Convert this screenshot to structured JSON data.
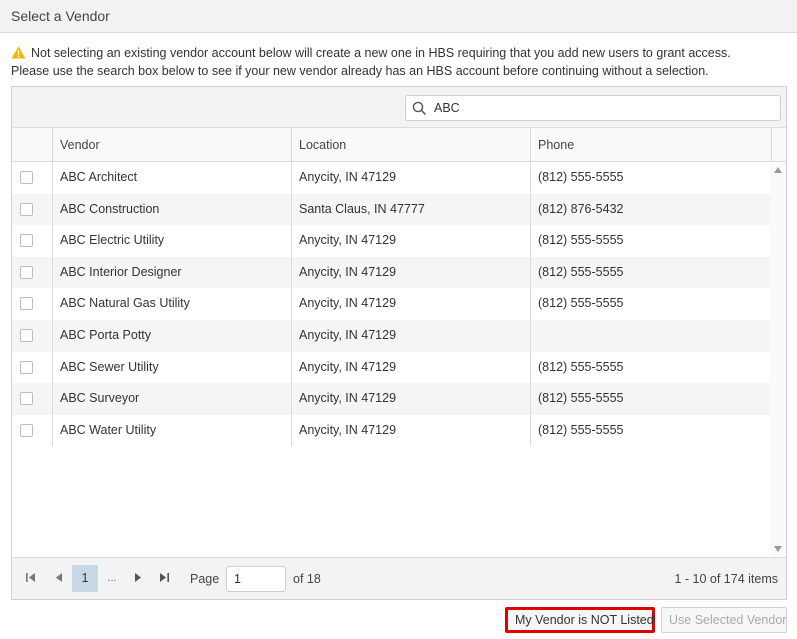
{
  "dialog": {
    "title": "Select a Vendor"
  },
  "warning": {
    "line1": "Not selecting an existing vendor account below will create a new one in HBS requiring that you add new users to grant access.",
    "line2": "Please use the search box below to see if your new vendor already has an HBS account before continuing without a selection."
  },
  "search": {
    "value": "ABC",
    "placeholder": ""
  },
  "columns": {
    "vendor": "Vendor",
    "location": "Location",
    "phone": "Phone"
  },
  "rows": [
    {
      "vendor": "ABC Architect",
      "location": "Anycity, IN 47129",
      "phone": "(812) 555-5555"
    },
    {
      "vendor": "ABC Construction",
      "location": "Santa Claus, IN 47777",
      "phone": "(812) 876-5432"
    },
    {
      "vendor": "ABC Electric Utility",
      "location": "Anycity, IN 47129",
      "phone": "(812) 555-5555"
    },
    {
      "vendor": "ABC Interior Designer",
      "location": "Anycity, IN 47129",
      "phone": "(812) 555-5555"
    },
    {
      "vendor": "ABC Natural Gas Utility",
      "location": "Anycity, IN 47129",
      "phone": "(812) 555-5555"
    },
    {
      "vendor": "ABC Porta Potty",
      "location": "Anycity, IN 47129",
      "phone": ""
    },
    {
      "vendor": "ABC Sewer Utility",
      "location": "Anycity, IN 47129",
      "phone": "(812) 555-5555"
    },
    {
      "vendor": "ABC Surveyor",
      "location": "Anycity, IN 47129",
      "phone": "(812) 555-5555"
    },
    {
      "vendor": "ABC Water Utility",
      "location": "Anycity, IN 47129",
      "phone": "(812) 555-5555"
    }
  ],
  "pager": {
    "current_page": "1",
    "ellipsis": "...",
    "page_label": "Page",
    "page_input": "1",
    "of_label": "of 18",
    "items_info": "1 - 10 of 174 items"
  },
  "buttons": {
    "not_listed": "My Vendor is NOT Listed",
    "use_selected": "Use Selected Vendor"
  },
  "colors": {
    "highlight_border": "#e00000",
    "active_page": "#c8d8e6",
    "warning_icon": "#f0b400"
  }
}
